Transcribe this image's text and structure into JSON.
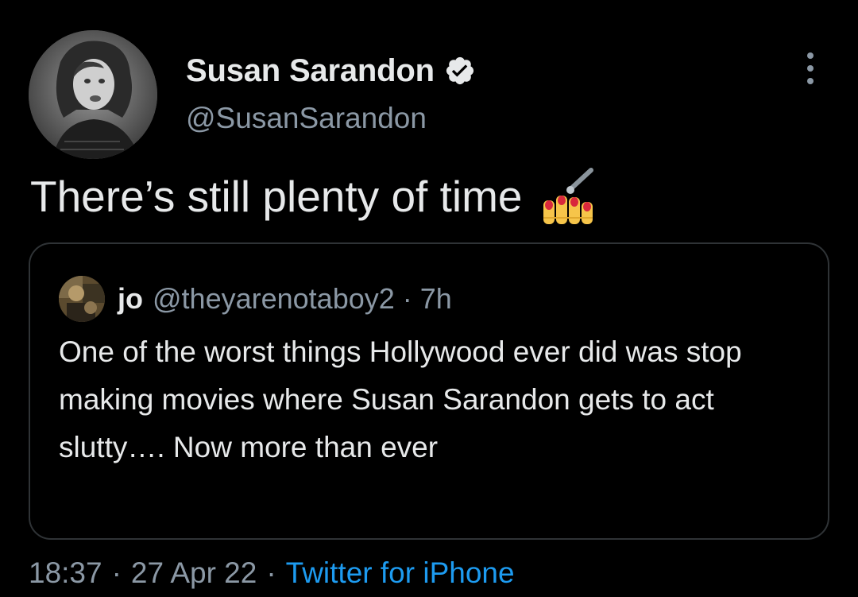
{
  "author": {
    "display_name": "Susan Sarandon",
    "handle": "@SusanSarandon",
    "verified": true
  },
  "tweet": {
    "text": "There’s still plenty of time",
    "emoji": "nail-polish-icon"
  },
  "quoted_tweet": {
    "name": "jo",
    "handle": "@theyarenotaboy2",
    "separator": "·",
    "time": "7h",
    "text": "One of the worst things Hollywood ever did was stop making movies where Susan Sarandon gets to act slutty…. Now more than ever"
  },
  "meta": {
    "time": "18:37",
    "separator": "·",
    "date": "27 Apr 22",
    "source": "Twitter for iPhone"
  },
  "colors": {
    "background": "#000000",
    "text_primary": "#e7e9ea",
    "text_secondary": "#8b98a5",
    "link": "#1d9bf0",
    "border": "#2f3336"
  }
}
